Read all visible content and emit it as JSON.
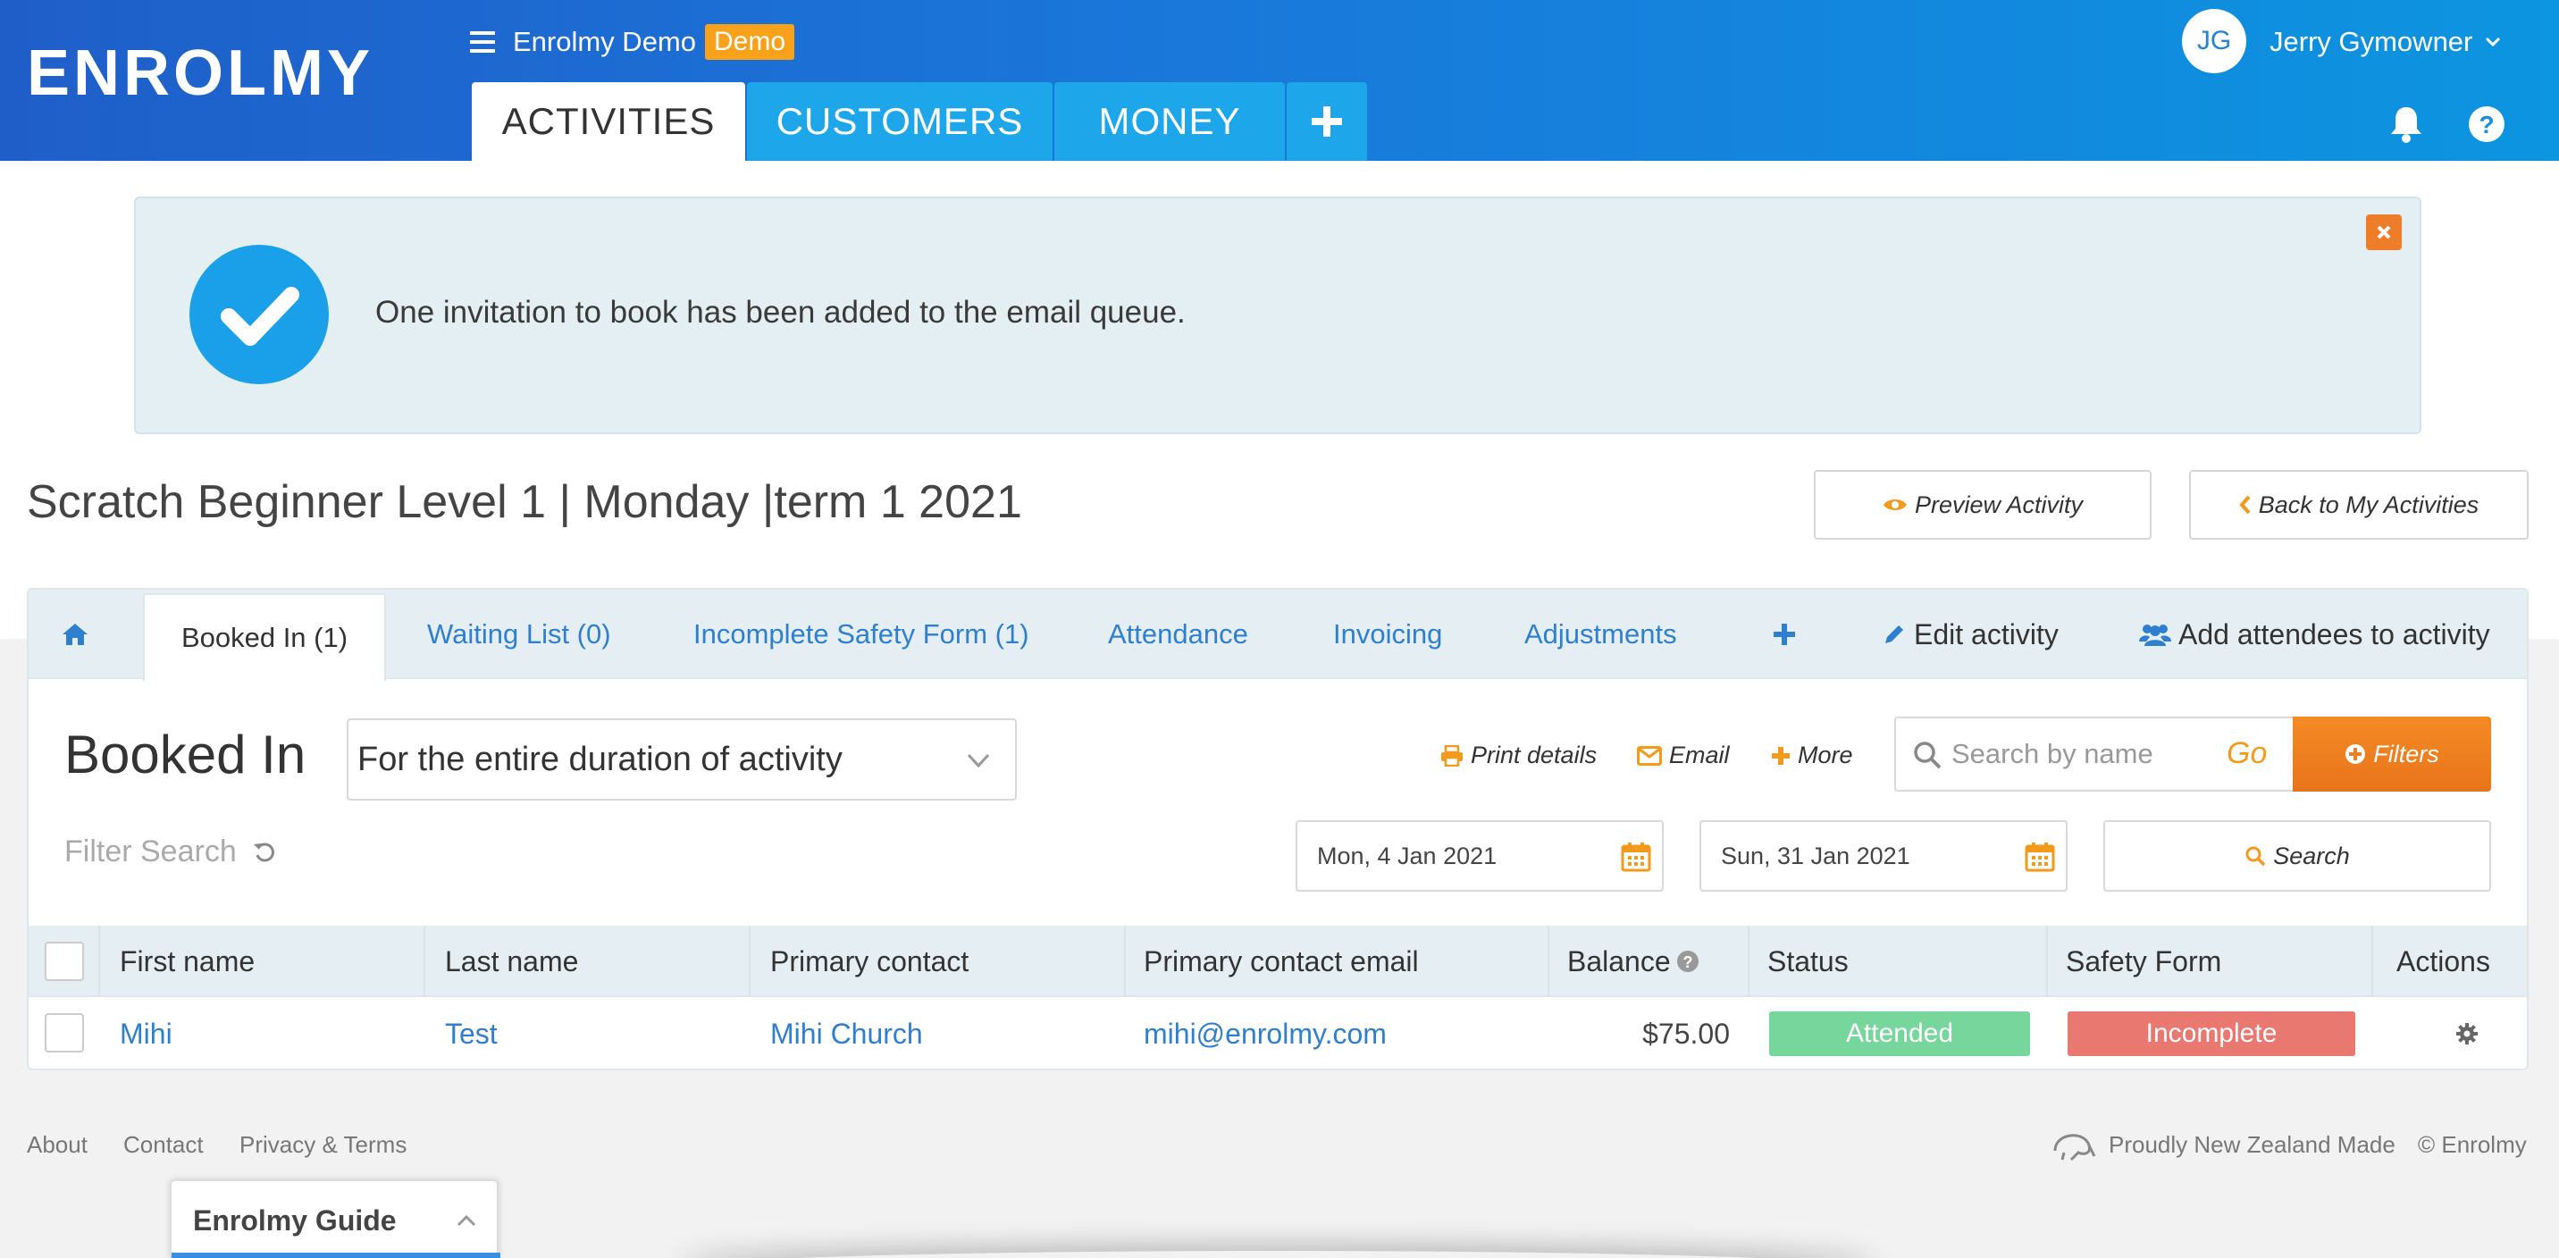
{
  "header": {
    "logo_text": "ENROLMY",
    "org_name": "Enrolmy Demo",
    "demo_badge": "Demo",
    "tabs": [
      {
        "label": "ACTIVITIES"
      },
      {
        "label": "CUSTOMERS"
      },
      {
        "label": "MONEY"
      }
    ],
    "user_initials": "JG",
    "user_name": "Jerry Gymowner"
  },
  "alert": {
    "message": "One invitation to book has been added to the email queue."
  },
  "page": {
    "title": "Scratch Beginner Level 1 | Monday |term 1 2021",
    "preview_label": "Preview Activity",
    "back_label": "Back to My Activities"
  },
  "subnav": {
    "booked_in": "Booked In (1)",
    "waiting_list": "Waiting List (0)",
    "incomplete_safety": "Incomplete Safety Form (1)",
    "attendance": "Attendance",
    "invoicing": "Invoicing",
    "adjustments": "Adjustments",
    "edit_activity": "Edit activity",
    "add_attendees": "Add attendees to activity"
  },
  "booked": {
    "heading": "Booked In",
    "duration_value": "For the entire duration of activity",
    "print_label": "Print details",
    "email_label": "Email",
    "more_label": "More",
    "search_placeholder": "Search by name",
    "go_label": "Go",
    "filters_label": "Filters",
    "filter_search_label": "Filter Search",
    "date_from": "Mon, 4 Jan 2021",
    "date_to": "Sun, 31 Jan 2021",
    "search_label": "Search"
  },
  "table": {
    "columns": [
      "First name",
      "Last name",
      "Primary contact",
      "Primary contact email",
      "Balance",
      "Status",
      "Safety Form",
      "Actions"
    ],
    "rows": [
      {
        "first_name": "Mihi",
        "last_name": "Test",
        "primary_contact": "Mihi Church",
        "email": "mihi@enrolmy.com",
        "balance": "$75.00",
        "status": "Attended",
        "safety_form": "Incomplete"
      }
    ]
  },
  "footer": {
    "about": "About",
    "contact": "Contact",
    "privacy": "Privacy & Terms",
    "made_in": "Proudly New Zealand Made",
    "copyright": "© Enrolmy",
    "guide_title": "Enrolmy Guide"
  },
  "colors": {
    "header_blue": "#1a77da",
    "tab_blue": "#1ea6ea",
    "link_blue": "#2e7fcf",
    "accent_orange": "#f39a1b",
    "demo_badge": "#f7a21a",
    "attended_green": "#77d69b",
    "incomplete_red": "#e87870"
  },
  "icons": [
    "menu-icon",
    "plus-icon",
    "bell-icon",
    "help-icon",
    "check-circle-icon",
    "close-icon",
    "eye-icon",
    "chevron-left-icon",
    "home-icon",
    "pencil-icon",
    "users-icon",
    "chevron-down-icon",
    "print-icon",
    "envelope-icon",
    "search-icon",
    "plus-circle-icon",
    "refresh-icon",
    "calendar-icon",
    "gear-icon",
    "kiwi-icon"
  ]
}
